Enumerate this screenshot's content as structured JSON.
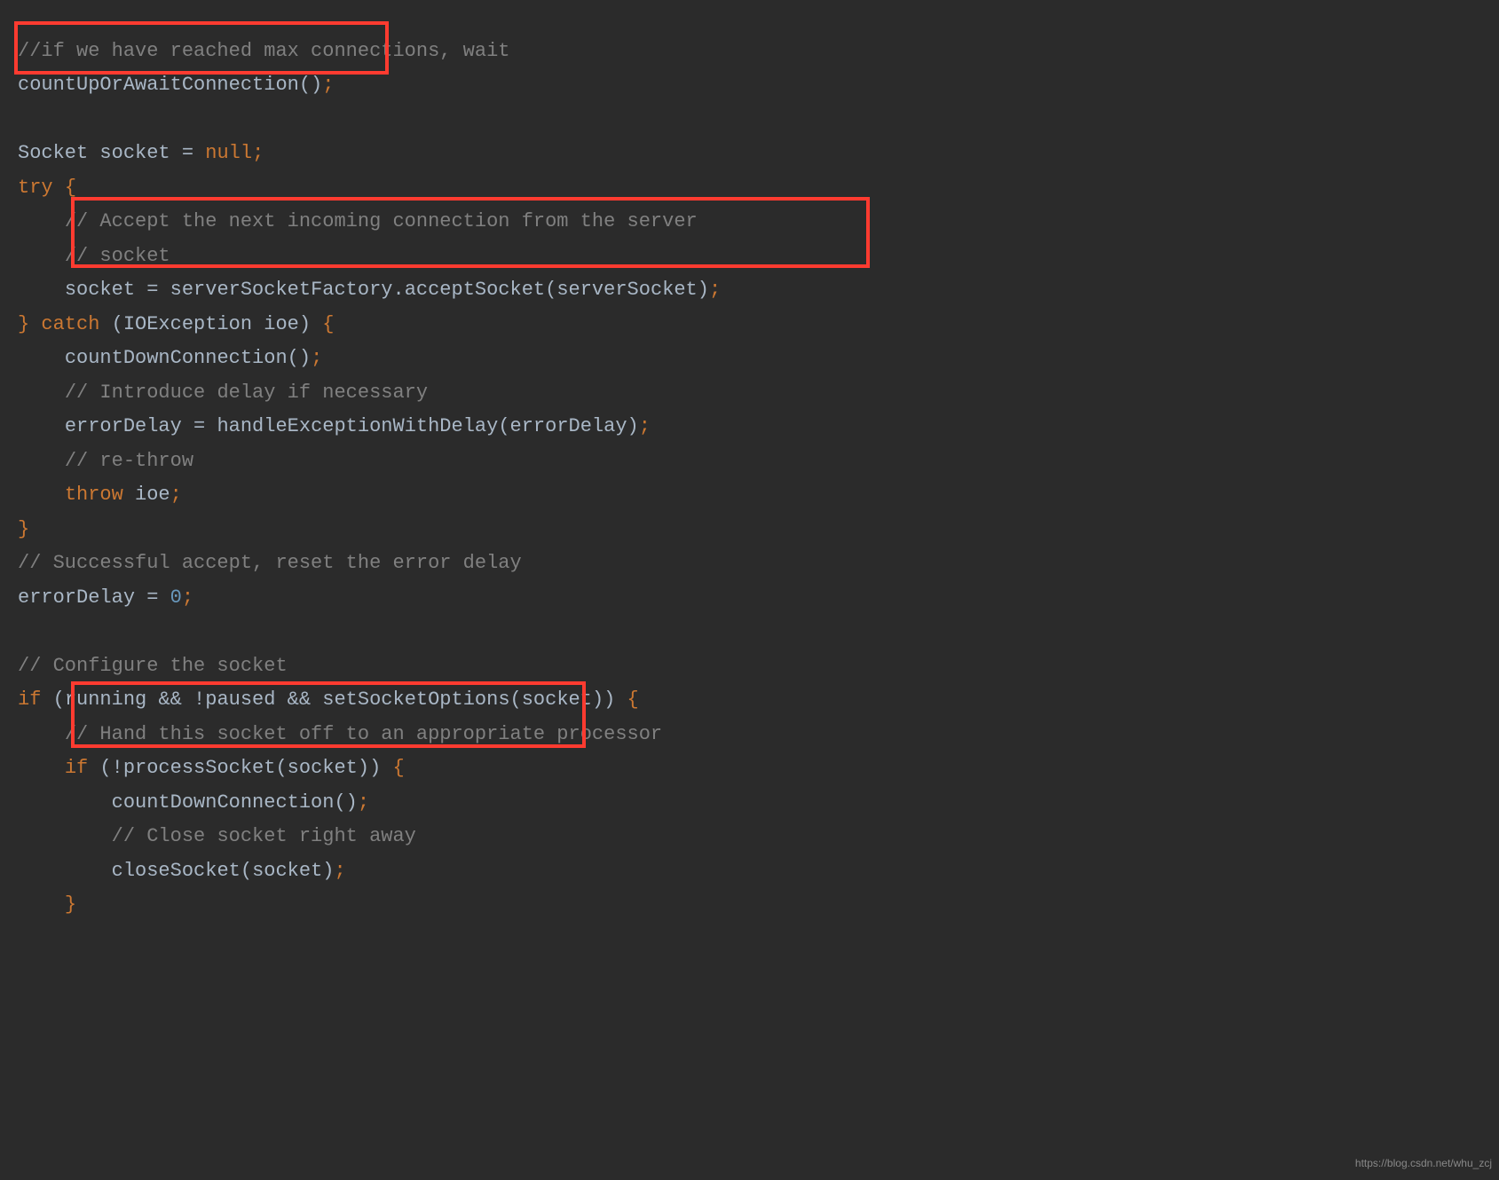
{
  "watermark": "https://blog.csdn.net/whu_zcj",
  "code": {
    "l1_comment": "//if we have reached max connections, wait",
    "l2_call": "countUpOrAwaitConnection",
    "l4_type": "Socket",
    "l4_var": "socket",
    "l4_null": "null",
    "l5_try": "try",
    "l6_comment": "// Accept the next incoming connection from the server",
    "l7_comment": "// socket",
    "l8_lhs": "socket",
    "l8_obj": "serverSocketFactory",
    "l8_method": "acceptSocket",
    "l8_arg": "serverSocket",
    "l9_catch": "catch",
    "l9_extype": "IOException",
    "l9_exvar": "ioe",
    "l10_call": "countDownConnection",
    "l11_comment": "// Introduce delay if necessary",
    "l12_lhs": "errorDelay",
    "l12_method": "handleExceptionWithDelay",
    "l12_arg": "errorDelay",
    "l13_comment": "// re-throw",
    "l14_throw": "throw",
    "l14_var": "ioe",
    "l16_comment": "// Successful accept, reset the error delay",
    "l17_lhs": "errorDelay",
    "l17_val": "0",
    "l19_comment": "// Configure the socket",
    "l20_if": "if",
    "l20_running": "running",
    "l20_paused": "paused",
    "l20_setopts": "setSocketOptions",
    "l20_arg": "socket",
    "l21_comment": "// Hand this socket off to an appropriate processor",
    "l22_if": "if",
    "l22_proc": "processSocket",
    "l22_arg": "socket",
    "l23_call": "countDownConnection",
    "l24_comment": "// Close socket right away",
    "l25_call": "closeSocket",
    "l25_arg": "socket"
  }
}
